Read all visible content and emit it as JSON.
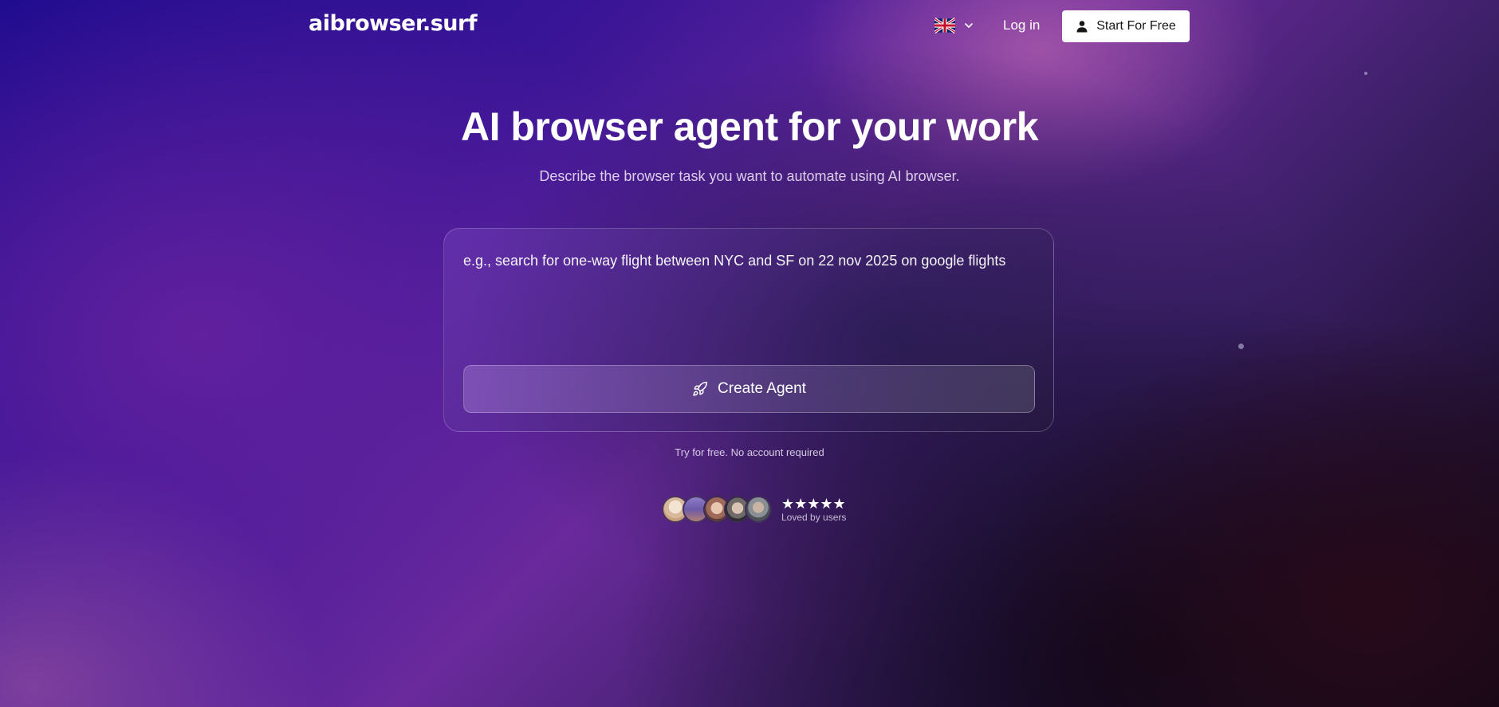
{
  "header": {
    "logo": "aibrowser.surf",
    "language_icon": "uk-flag-icon",
    "login_label": "Log in",
    "start_label": "Start For Free"
  },
  "hero": {
    "title": "AI browser agent for your work",
    "subtitle": "Describe the browser task you want to automate using AI browser."
  },
  "prompt": {
    "placeholder": "e.g., search for one-way flight between NYC and SF on 22 nov 2025 on google flights",
    "value": ""
  },
  "create_button": {
    "label": "Create Agent",
    "icon": "rocket-icon"
  },
  "note": "Try for free. No account required",
  "social_proof": {
    "stars": "★★★★★",
    "caption": "Loved by users",
    "avatar_count": 5
  },
  "colors": {
    "button_bg": "#ffffff",
    "text": "#ffffff"
  }
}
